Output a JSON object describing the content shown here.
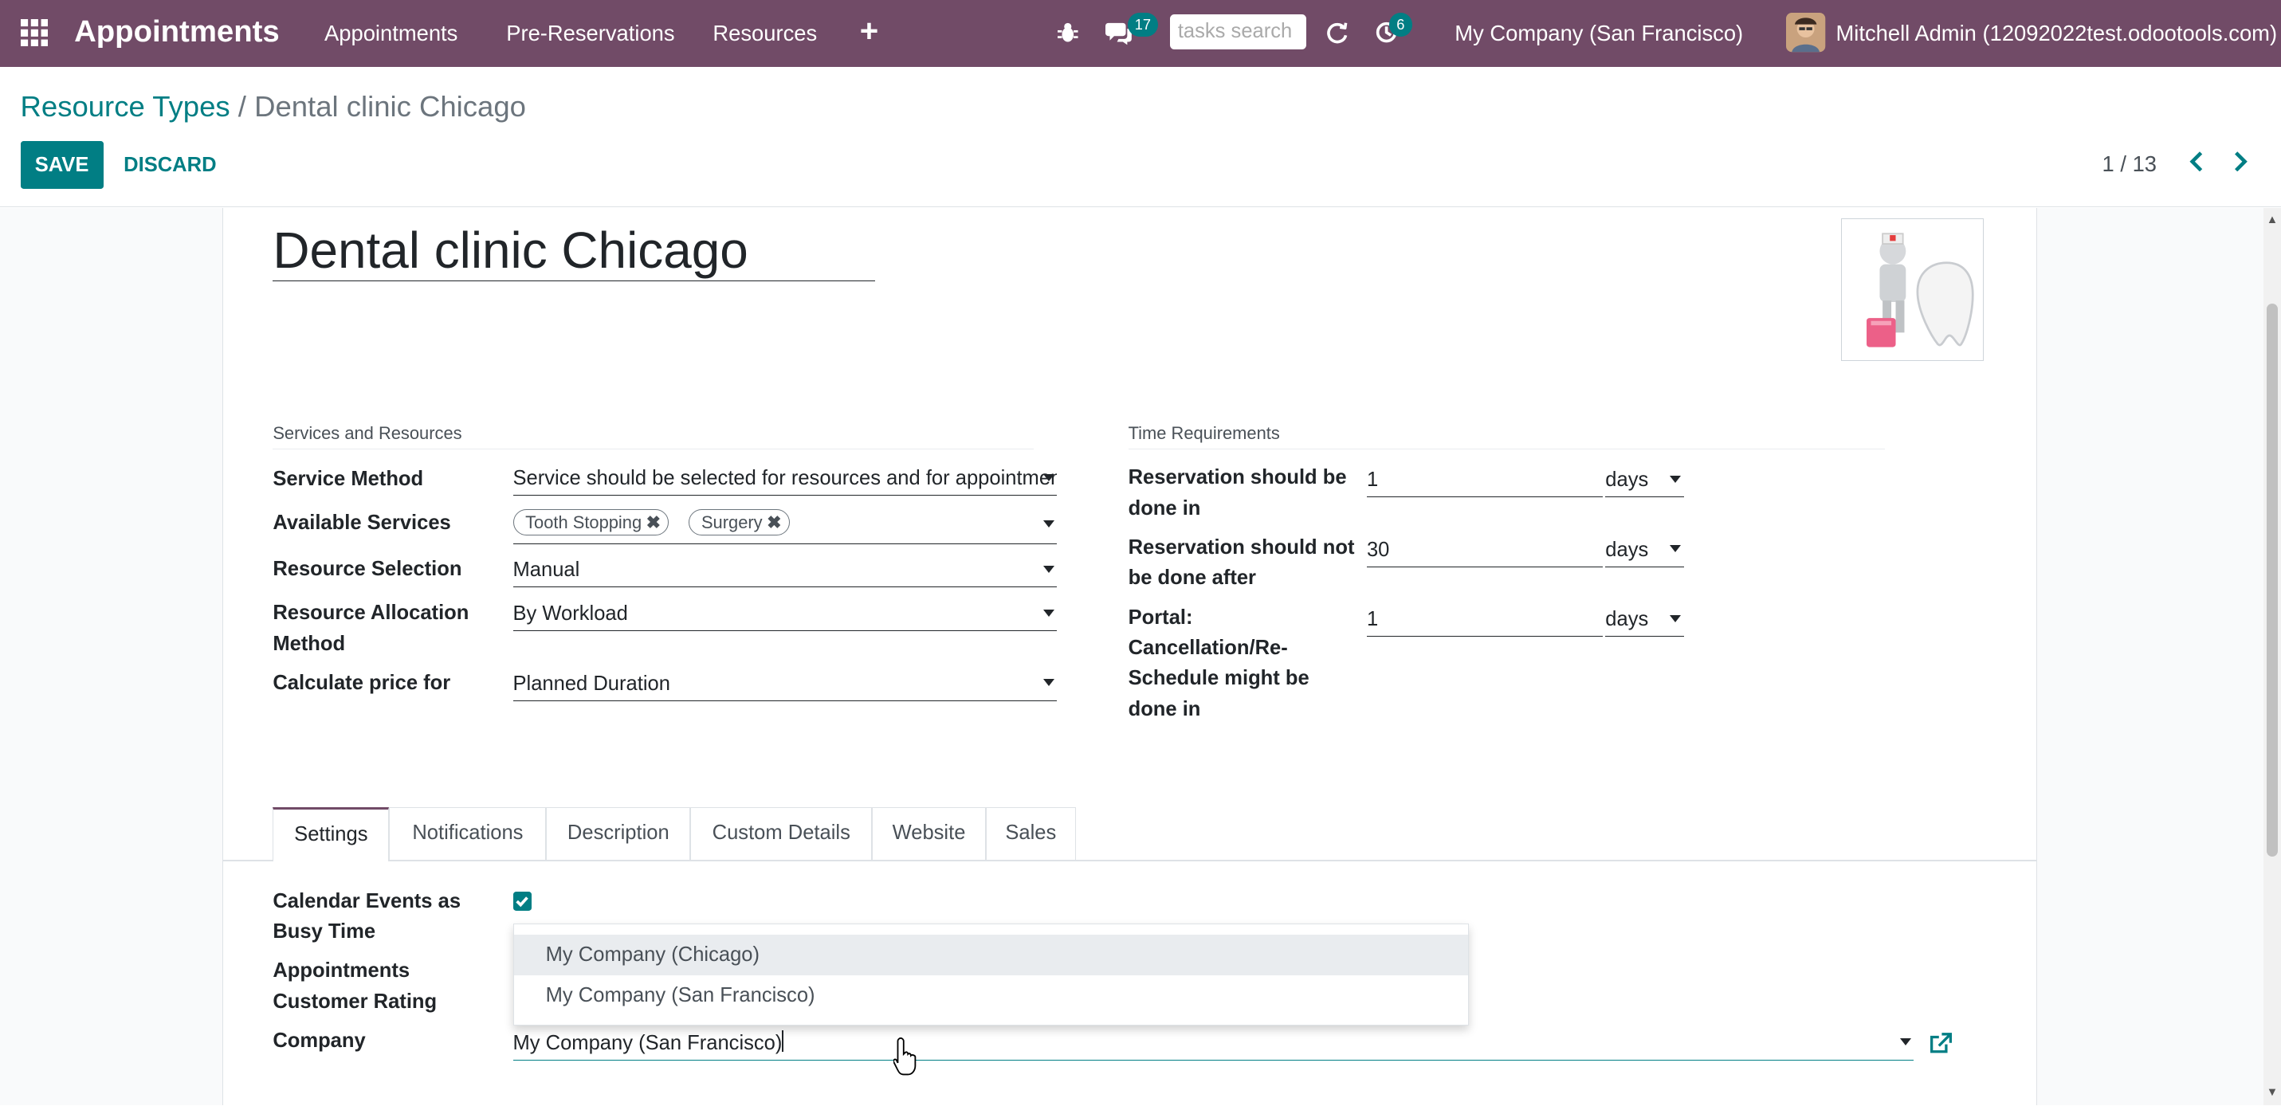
{
  "navbar": {
    "app_name": "Appointments",
    "menus": [
      "Appointments",
      "Pre-Reservations",
      "Resources"
    ],
    "plus": "+",
    "messages_badge": "17",
    "search_placeholder": "tasks search",
    "activities_badge": "6",
    "company": "My Company (San Francisco)",
    "user": "Mitchell Admin (12092022test.odootools.com)"
  },
  "breadcrumb": {
    "parent": "Resource Types",
    "separator": "/",
    "current": "Dental clinic Chicago"
  },
  "actions": {
    "save": "SAVE",
    "discard": "DISCARD"
  },
  "pager": {
    "value": "1 / 13"
  },
  "record": {
    "name": "Dental clinic Chicago"
  },
  "services_group": {
    "title": "Services and Resources",
    "service_method_label": "Service Method",
    "service_method_value": "Service should be selected for resources and for appointments",
    "available_services_label": "Available Services",
    "tags": [
      "Tooth Stopping",
      "Surgery"
    ],
    "resource_selection_label": "Resource Selection",
    "resource_selection_value": "Manual",
    "allocation_label_1": "Resource Allocation",
    "allocation_label_2": "Method",
    "allocation_value": "By Workload",
    "price_label": "Calculate price for",
    "price_value": "Planned Duration"
  },
  "time_group": {
    "title": "Time Requirements",
    "row1_label_1": "Reservation should be",
    "row1_label_2": "done in",
    "row1_value": "1",
    "row1_unit": "days",
    "row2_label_1": "Reservation should not",
    "row2_label_2": "be done after",
    "row2_value": "30",
    "row2_unit": "days",
    "row3_label_1": "Portal:",
    "row3_label_2": "Cancellation/Re-",
    "row3_label_3": "Schedule might be",
    "row3_label_4": "done in",
    "row3_value": "1",
    "row3_unit": "days"
  },
  "tabs": [
    "Settings",
    "Notifications",
    "Description",
    "Custom Details",
    "Website",
    "Sales"
  ],
  "settings": {
    "calendar_label_1": "Calendar Events as",
    "calendar_label_2": "Busy Time",
    "calendar_checked": true,
    "rating_label_1": "Appointments",
    "rating_label_2": "Customer Rating",
    "company_label": "Company",
    "company_value": "My Company (San Francisco)",
    "dropdown_options": [
      "My Company (Chicago)",
      "My Company (San Francisco)"
    ]
  },
  "colors": {
    "navbar": "#714b67",
    "accent": "#017e84"
  },
  "icons": [
    "apps-icon",
    "bug-icon",
    "chat-icon",
    "refresh-icon",
    "activity-clock-icon",
    "chevron-left-icon",
    "chevron-right-icon",
    "external-link-icon",
    "checkbox-icon",
    "hand-cursor-icon"
  ]
}
